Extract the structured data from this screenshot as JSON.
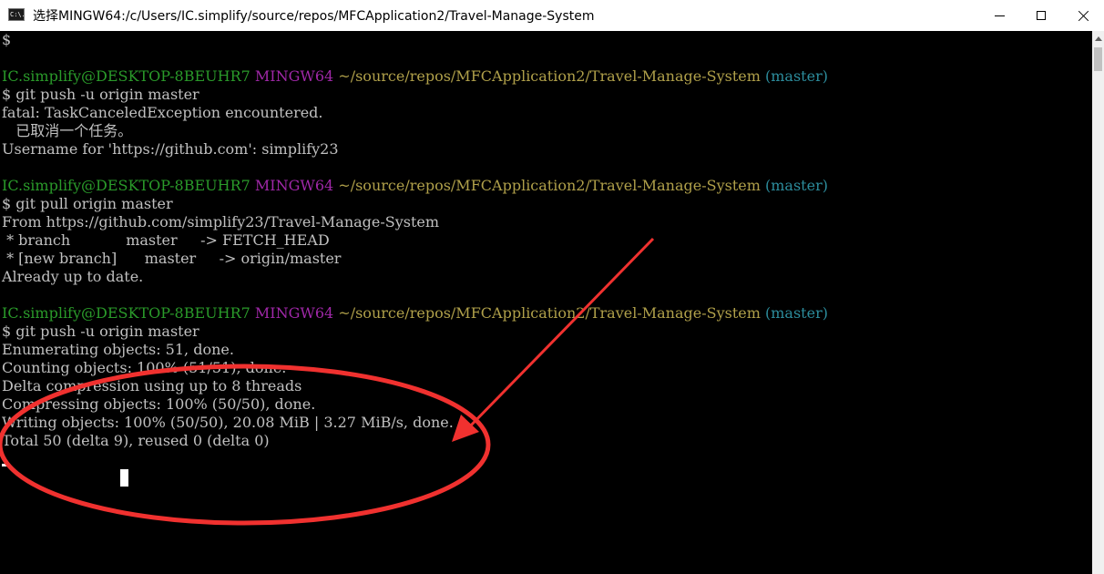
{
  "window": {
    "title": "选择MINGW64:/c/Users/IC.simplify/source/repos/MFCApplication2/Travel-Manage-System",
    "icon_text": "C:\\."
  },
  "terminal": {
    "prompt_user": "IC.simplify@DESKTOP-8BEUHR7",
    "prompt_env": "MINGW64",
    "prompt_path": "~/source/repos/MFCApplication2/Travel-Manage-System",
    "prompt_branch": "(master)",
    "line_top": "$",
    "block1": {
      "command": "$ git push -u origin master",
      "out": [
        "fatal: TaskCanceledException encountered.",
        "   已取消一个任务。",
        "Username for 'https://github.com': simplify23"
      ]
    },
    "block2": {
      "command": "$ git pull origin master",
      "out": [
        "From https://github.com/simplify23/Travel-Manage-System",
        " * branch            master     -> FETCH_HEAD",
        " * [new branch]      master     -> origin/master",
        "Already up to date."
      ]
    },
    "block3": {
      "command": "$ git push -u origin master",
      "out": [
        "Enumerating objects: 51, done.",
        "Counting objects: 100% (51/51), done.",
        "Delta compression using up to 8 threads",
        "Compressing objects: 100% (50/50), done.",
        "Writing objects: 100% (50/50), 20.08 MiB | 3.27 MiB/s, done.",
        "Total 50 (delta 9), reused 0 (delta 0)"
      ]
    }
  },
  "colors": {
    "terminal_bg": "#000000",
    "text": "#c0c0c0",
    "prompt_user": "#2a9a2a",
    "prompt_env": "#a028a8",
    "prompt_path": "#b0a04a",
    "prompt_branch": "#2c8c9c",
    "annotation": "#f0312f"
  }
}
